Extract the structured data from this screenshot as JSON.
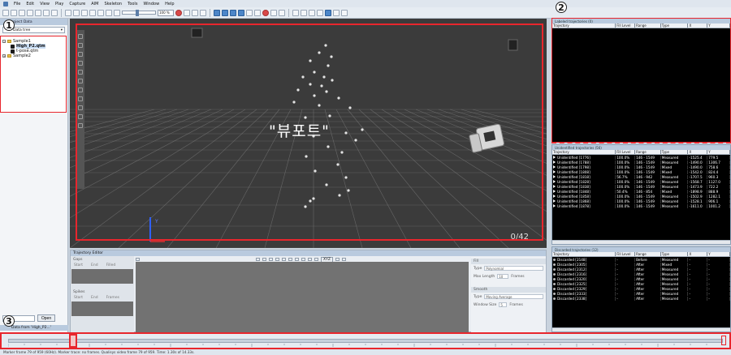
{
  "menu": {
    "items": [
      "File",
      "Edit",
      "View",
      "Play",
      "Capture",
      "AIM",
      "Skeleton",
      "Tools",
      "Window",
      "Help"
    ]
  },
  "toolbar": {
    "zoom_value": "100 %"
  },
  "left_panel": {
    "title": "Project Data",
    "dropdown_value": "Data tree",
    "tree": [
      {
        "label": "Sample1",
        "type": "folder",
        "level": 0
      },
      {
        "label": "High_P2.qtm",
        "type": "file",
        "level": 1,
        "selected": true
      },
      {
        "label": "t-pose.qtm",
        "type": "file",
        "level": 1
      },
      {
        "label": "Sample2",
        "type": "folder",
        "level": 0
      }
    ],
    "open_button": "Open",
    "bottom_label": "Data from 'High_P2...'"
  },
  "viewport": {
    "overlay_text": "\"뷰포트\"",
    "frame_counter": "0/42"
  },
  "labeled_panel": {
    "title": "Labeled trajectories (0)",
    "columns": [
      "Trajectory",
      "Fill Level",
      "Range",
      "Type",
      "X",
      "Y"
    ]
  },
  "unidentified_panel": {
    "title": "Unidentified trajectories (56)",
    "columns": [
      "Trajectory",
      "Fill Level",
      "Range",
      "Type",
      "X",
      "Y"
    ],
    "rows": [
      [
        "Unidentified [1776]",
        "100.0%",
        "146 - 1549",
        "Measured",
        "-1525.4",
        "779.5"
      ],
      [
        "Unidentified [1788]",
        "100.0%",
        "146 - 1549",
        "Measured",
        "-1490.0",
        "1306.7"
      ],
      [
        "Unidentified [1798]",
        "100.0%",
        "146 - 1549",
        "Mixed",
        "-1490.0",
        "758.6"
      ],
      [
        "Unidentified [1808]",
        "100.0%",
        "146 - 1549",
        "Mixed",
        "-1542.0",
        "824.4"
      ],
      [
        "Unidentified [1818]",
        "56.7%",
        "146 - 942",
        "Measured",
        "-1707.5",
        "960.3"
      ],
      [
        "Unidentified [1828]",
        "100.0%",
        "146 - 1549",
        "Measured",
        "-1568.7",
        "1127.0"
      ],
      [
        "Unidentified [1838]",
        "100.0%",
        "146 - 1549",
        "Measured",
        "-1473.9",
        "722.2"
      ],
      [
        "Unidentified [1848]",
        "50.4%",
        "146 - 854",
        "Mixed",
        "-1898.9",
        "888.9"
      ],
      [
        "Unidentified [1858]",
        "100.0%",
        "146 - 1549",
        "Measured",
        "-1502.9",
        "1282.1"
      ],
      [
        "Unidentified [1868]",
        "100.0%",
        "146 - 1549",
        "Measured",
        "-1528.1",
        "906.1"
      ],
      [
        "Unidentified [1878]",
        "100.0%",
        "146 - 1549",
        "Measured",
        "-1611.0",
        "1001.2"
      ]
    ]
  },
  "discarded_panel": {
    "title": "Discarded trajectories (12)",
    "columns": [
      "Trajectory",
      "Fill Level",
      "Range",
      "Type",
      "X",
      "Y"
    ],
    "rows": [
      [
        "Discarded [2148]",
        "-",
        "Before",
        "Measured",
        "-",
        "-"
      ],
      [
        "Discarded [2305]",
        "-",
        "After",
        "Mixed",
        "-",
        "-"
      ],
      [
        "Discarded [2312]",
        "-",
        "After",
        "Measured",
        "-",
        "-"
      ],
      [
        "Discarded [2316]",
        "-",
        "After",
        "Measured",
        "-",
        "-"
      ],
      [
        "Discarded [2320]",
        "-",
        "After",
        "Measured",
        "-",
        "-"
      ],
      [
        "Discarded [2325]",
        "-",
        "After",
        "Measured",
        "-",
        "-"
      ],
      [
        "Discarded [2329]",
        "-",
        "After",
        "Measured",
        "-",
        "-"
      ],
      [
        "Discarded [2333]",
        "-",
        "After",
        "Measured",
        "-",
        "-"
      ],
      [
        "Discarded [2338]",
        "-",
        "After",
        "Measured",
        "-",
        "-"
      ]
    ]
  },
  "trajectory_editor": {
    "title": "Trajectory Editor",
    "gaps_label": "Gaps",
    "spikes_label": "Spikes",
    "col_start": "Start",
    "col_end": "End",
    "col_filled": "Filled",
    "col_frames": "Frames",
    "fill_header": "Fill",
    "type_label": "Type",
    "type_value": "Polynomial",
    "max_length_label": "Max Length",
    "max_length_value": "10",
    "frames_label": "Frames",
    "smooth_header": "Smooth",
    "smooth_type_value": "Moving Average",
    "window_size_label": "Window Size",
    "window_size_value": "5",
    "axis_value": "XYZ"
  },
  "statusbar": {
    "text": "Marker frame 79 of 959 (60Hz). Marker trace: no frames. Qualisys video frame 79 of 959. Time: 1.30s of 14.33s."
  },
  "callouts": [
    "1",
    "2",
    "3"
  ],
  "colors": {
    "annotation_red": "#e8262d",
    "viewport_bg": "#3b3b3b",
    "panel_header": "#b9cade"
  }
}
